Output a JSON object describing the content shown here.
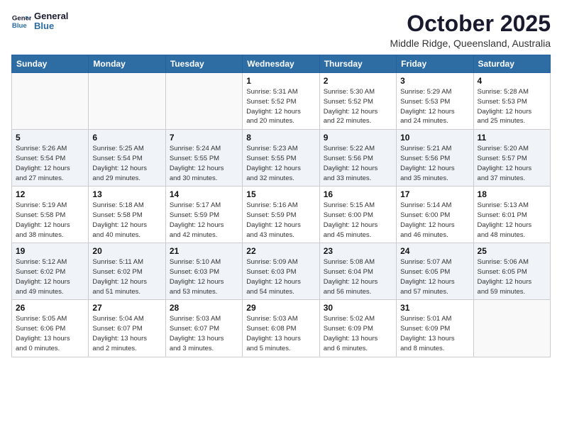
{
  "header": {
    "logo_line1": "General",
    "logo_line2": "Blue",
    "month": "October 2025",
    "location": "Middle Ridge, Queensland, Australia"
  },
  "weekdays": [
    "Sunday",
    "Monday",
    "Tuesday",
    "Wednesday",
    "Thursday",
    "Friday",
    "Saturday"
  ],
  "weeks": [
    [
      {
        "day": "",
        "info": ""
      },
      {
        "day": "",
        "info": ""
      },
      {
        "day": "",
        "info": ""
      },
      {
        "day": "1",
        "info": "Sunrise: 5:31 AM\nSunset: 5:52 PM\nDaylight: 12 hours\nand 20 minutes."
      },
      {
        "day": "2",
        "info": "Sunrise: 5:30 AM\nSunset: 5:52 PM\nDaylight: 12 hours\nand 22 minutes."
      },
      {
        "day": "3",
        "info": "Sunrise: 5:29 AM\nSunset: 5:53 PM\nDaylight: 12 hours\nand 24 minutes."
      },
      {
        "day": "4",
        "info": "Sunrise: 5:28 AM\nSunset: 5:53 PM\nDaylight: 12 hours\nand 25 minutes."
      }
    ],
    [
      {
        "day": "5",
        "info": "Sunrise: 5:26 AM\nSunset: 5:54 PM\nDaylight: 12 hours\nand 27 minutes."
      },
      {
        "day": "6",
        "info": "Sunrise: 5:25 AM\nSunset: 5:54 PM\nDaylight: 12 hours\nand 29 minutes."
      },
      {
        "day": "7",
        "info": "Sunrise: 5:24 AM\nSunset: 5:55 PM\nDaylight: 12 hours\nand 30 minutes."
      },
      {
        "day": "8",
        "info": "Sunrise: 5:23 AM\nSunset: 5:55 PM\nDaylight: 12 hours\nand 32 minutes."
      },
      {
        "day": "9",
        "info": "Sunrise: 5:22 AM\nSunset: 5:56 PM\nDaylight: 12 hours\nand 33 minutes."
      },
      {
        "day": "10",
        "info": "Sunrise: 5:21 AM\nSunset: 5:56 PM\nDaylight: 12 hours\nand 35 minutes."
      },
      {
        "day": "11",
        "info": "Sunrise: 5:20 AM\nSunset: 5:57 PM\nDaylight: 12 hours\nand 37 minutes."
      }
    ],
    [
      {
        "day": "12",
        "info": "Sunrise: 5:19 AM\nSunset: 5:58 PM\nDaylight: 12 hours\nand 38 minutes."
      },
      {
        "day": "13",
        "info": "Sunrise: 5:18 AM\nSunset: 5:58 PM\nDaylight: 12 hours\nand 40 minutes."
      },
      {
        "day": "14",
        "info": "Sunrise: 5:17 AM\nSunset: 5:59 PM\nDaylight: 12 hours\nand 42 minutes."
      },
      {
        "day": "15",
        "info": "Sunrise: 5:16 AM\nSunset: 5:59 PM\nDaylight: 12 hours\nand 43 minutes."
      },
      {
        "day": "16",
        "info": "Sunrise: 5:15 AM\nSunset: 6:00 PM\nDaylight: 12 hours\nand 45 minutes."
      },
      {
        "day": "17",
        "info": "Sunrise: 5:14 AM\nSunset: 6:00 PM\nDaylight: 12 hours\nand 46 minutes."
      },
      {
        "day": "18",
        "info": "Sunrise: 5:13 AM\nSunset: 6:01 PM\nDaylight: 12 hours\nand 48 minutes."
      }
    ],
    [
      {
        "day": "19",
        "info": "Sunrise: 5:12 AM\nSunset: 6:02 PM\nDaylight: 12 hours\nand 49 minutes."
      },
      {
        "day": "20",
        "info": "Sunrise: 5:11 AM\nSunset: 6:02 PM\nDaylight: 12 hours\nand 51 minutes."
      },
      {
        "day": "21",
        "info": "Sunrise: 5:10 AM\nSunset: 6:03 PM\nDaylight: 12 hours\nand 53 minutes."
      },
      {
        "day": "22",
        "info": "Sunrise: 5:09 AM\nSunset: 6:03 PM\nDaylight: 12 hours\nand 54 minutes."
      },
      {
        "day": "23",
        "info": "Sunrise: 5:08 AM\nSunset: 6:04 PM\nDaylight: 12 hours\nand 56 minutes."
      },
      {
        "day": "24",
        "info": "Sunrise: 5:07 AM\nSunset: 6:05 PM\nDaylight: 12 hours\nand 57 minutes."
      },
      {
        "day": "25",
        "info": "Sunrise: 5:06 AM\nSunset: 6:05 PM\nDaylight: 12 hours\nand 59 minutes."
      }
    ],
    [
      {
        "day": "26",
        "info": "Sunrise: 5:05 AM\nSunset: 6:06 PM\nDaylight: 13 hours\nand 0 minutes."
      },
      {
        "day": "27",
        "info": "Sunrise: 5:04 AM\nSunset: 6:07 PM\nDaylight: 13 hours\nand 2 minutes."
      },
      {
        "day": "28",
        "info": "Sunrise: 5:03 AM\nSunset: 6:07 PM\nDaylight: 13 hours\nand 3 minutes."
      },
      {
        "day": "29",
        "info": "Sunrise: 5:03 AM\nSunset: 6:08 PM\nDaylight: 13 hours\nand 5 minutes."
      },
      {
        "day": "30",
        "info": "Sunrise: 5:02 AM\nSunset: 6:09 PM\nDaylight: 13 hours\nand 6 minutes."
      },
      {
        "day": "31",
        "info": "Sunrise: 5:01 AM\nSunset: 6:09 PM\nDaylight: 13 hours\nand 8 minutes."
      },
      {
        "day": "",
        "info": ""
      }
    ]
  ]
}
